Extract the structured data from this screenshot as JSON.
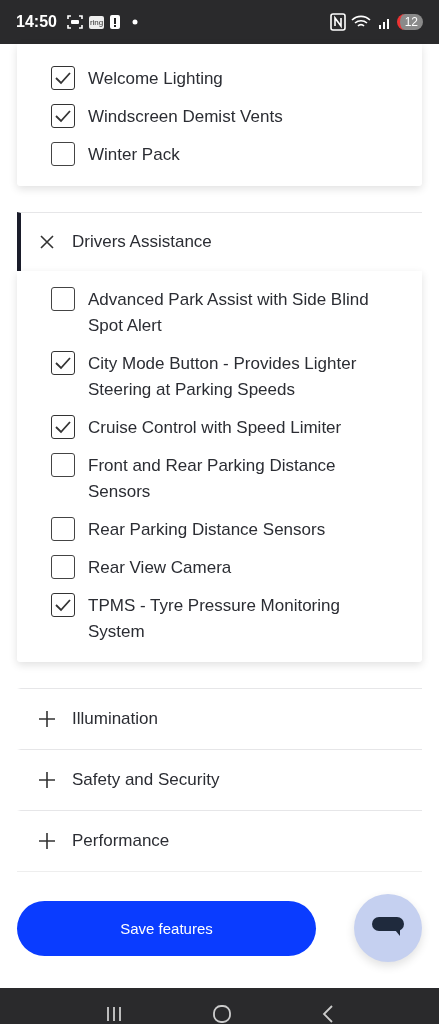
{
  "status_bar": {
    "time": "14:50",
    "app_icon_label": "ring",
    "notification_count": "12"
  },
  "top_list": [
    {
      "label": "Welcome Lighting",
      "checked": true
    },
    {
      "label": "Windscreen Demist Vents",
      "checked": true
    },
    {
      "label": "Winter Pack",
      "checked": false
    }
  ],
  "sections": [
    {
      "title": "Drivers Assistance",
      "expanded": true,
      "items": [
        {
          "label": "Advanced Park Assist with Side Blind Spot Alert",
          "checked": false
        },
        {
          "label": "City Mode Button - Provides Lighter Steering at Parking Speeds",
          "checked": true
        },
        {
          "label": "Cruise Control with Speed Limiter",
          "checked": true
        },
        {
          "label": "Front and Rear Parking Distance Sensors",
          "checked": false
        },
        {
          "label": "Rear Parking Distance Sensors",
          "checked": false
        },
        {
          "label": "Rear View Camera",
          "checked": false
        },
        {
          "label": "TPMS - Tyre Pressure Monitoring System",
          "checked": true
        }
      ]
    },
    {
      "title": "Illumination",
      "expanded": false
    },
    {
      "title": "Safety and Security",
      "expanded": false
    },
    {
      "title": "Performance",
      "expanded": false
    }
  ],
  "save_button": "Save features"
}
